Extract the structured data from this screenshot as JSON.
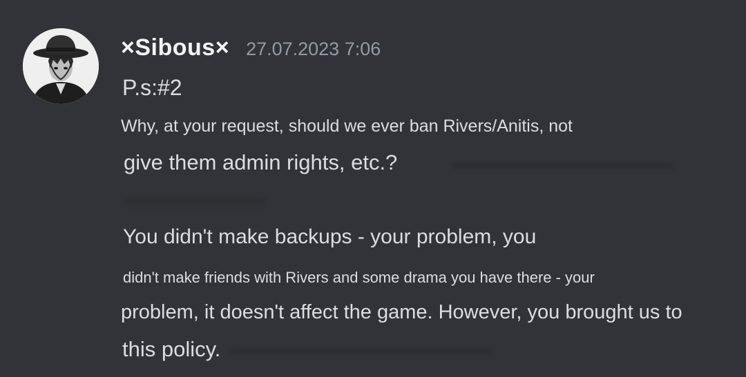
{
  "message": {
    "author": {
      "avatar_icon": "avatar-hat-figure-icon",
      "username": "×Sibous×"
    },
    "timestamp": "27.07.2023 7:06",
    "lines": [
      "P.s:#2",
      "Why, at your request, should we ever ban Rivers/Anitis, not",
      "give them admin rights, etc.?",
      "You didn't make backups - your problem, you",
      "didn't make friends with Rivers and some drama you have there - your",
      "problem, it doesn't affect the game. However, you brought us to",
      "this policy."
    ]
  },
  "colors": {
    "background": "#313338",
    "username": "#f2f3f5",
    "timestamp": "#949ba4",
    "text": "#dbdee1"
  }
}
